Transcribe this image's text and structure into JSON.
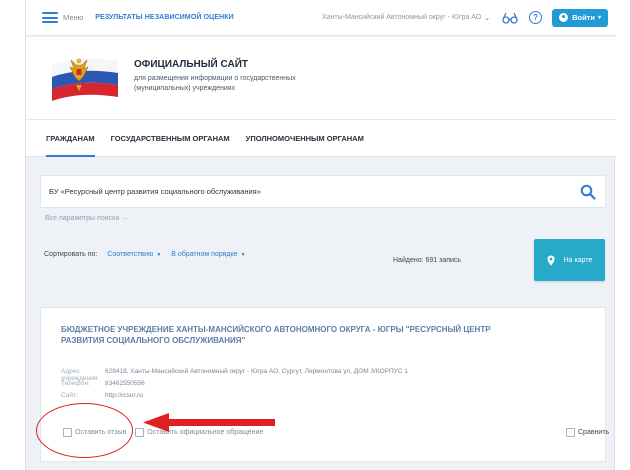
{
  "topbar": {
    "menu_label": "Меню",
    "results_link": "РЕЗУЛЬТАТЫ НЕЗАВИСИМОЙ ОЦЕНКИ",
    "region": "Ханты-Мансийский Автономный округ - Югра АО",
    "login_label": "Войти",
    "help_glyph": "?"
  },
  "header": {
    "title": "ОФИЦИАЛЬНЫЙ САЙТ",
    "subtitle": "для размещения информации о государственных (муниципальных) учреждениях"
  },
  "tabs": [
    {
      "label": "ГРАЖДАНАМ",
      "active": true
    },
    {
      "label": "ГОСУДАРСТВЕННЫМ ОРГАНАМ",
      "active": false
    },
    {
      "label": "УПОЛНОМОЧЕННЫМ ОРГАНАМ",
      "active": false
    }
  ],
  "search": {
    "value": "БУ «Ресурсный центр развития социального обслуживания»",
    "all_params_link": "Все параметры поиска →"
  },
  "sort": {
    "label": "Сортировать по:",
    "options": [
      "Соответствию",
      "В обратном порядке"
    ],
    "found": "Найдено: 691 запись",
    "map_button": "На карте"
  },
  "result": {
    "title": "БЮДЖЕТНОЕ УЧРЕЖДЕНИЕ ХАНТЫ-МАНСИЙСКОГО АВТОНОМНОГО ОКРУГА - ЮГРЫ \"РЕСУРСНЫЙ ЦЕНТР РАЗВИТИЯ СОЦИАЛЬНОГО ОБСЛУЖИВАНИЯ\"",
    "fields": [
      {
        "label": "Адрес учреждения:",
        "value": "628418, Ханты-Мансийский Автономный округ - Югра АО, Сургут, Лермонтова ул, ДОМ 3/КОРПУС 1"
      },
      {
        "label": "Телефон:",
        "value": "83462550556"
      },
      {
        "label": "Сайт:",
        "value": "http://rcsur.ru"
      }
    ],
    "actions": {
      "feedback": "Оставить отзыв",
      "appeal": "Оставить официальное обращение",
      "compare": "Сравнить"
    }
  },
  "colors": {
    "accent": "#2d7dd2",
    "map_button": "#27a9c9",
    "annotation": "#e02020"
  }
}
